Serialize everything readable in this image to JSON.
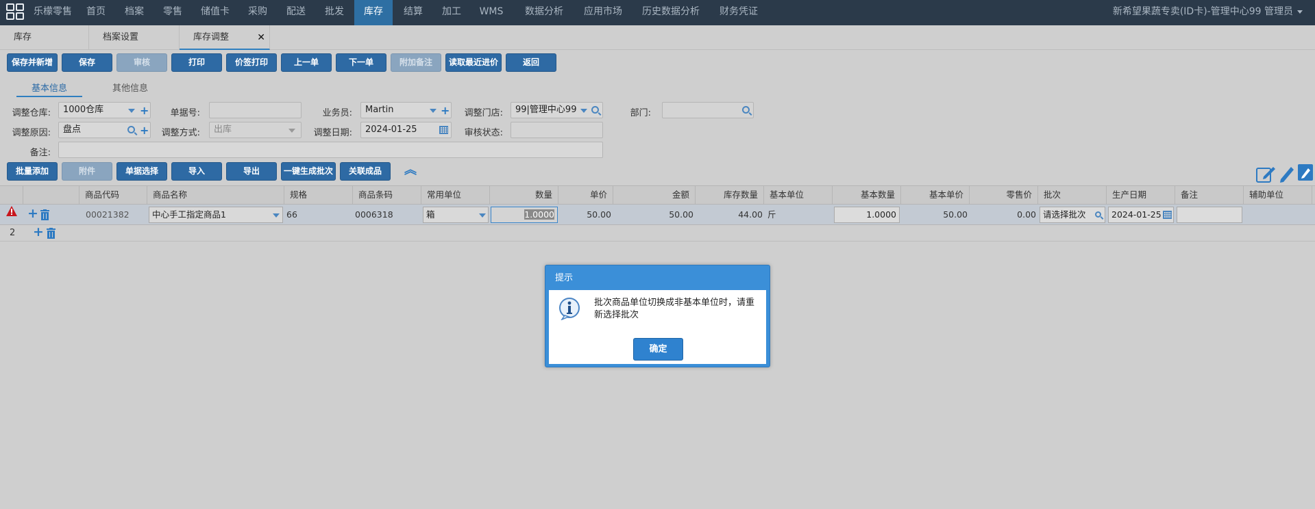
{
  "topnav": {
    "items": [
      "乐檬零售",
      "首页",
      "档案",
      "零售",
      "储值卡",
      "采购",
      "配送",
      "批发",
      "库存",
      "结算",
      "加工",
      "WMS",
      "数据分析",
      "应用市场",
      "历史数据分析",
      "财务凭证"
    ],
    "active": "库存",
    "user": "新希望果蔬专卖(ID卡)-管理中心99 管理员"
  },
  "tabs": [
    {
      "label": "库存"
    },
    {
      "label": "档案设置"
    },
    {
      "label": "库存调整"
    }
  ],
  "toolbar": {
    "buttons": [
      "保存并新增",
      "保存",
      "审核",
      "打印",
      "价签打印",
      "上一单",
      "下一单",
      "附加备注",
      "读取最近进价",
      "返回"
    ]
  },
  "subtabs": [
    "基本信息",
    "其他信息"
  ],
  "form": {
    "warehouse_label": "调整仓库:",
    "warehouse_value": "1000仓库",
    "docno_label": "单据号:",
    "docno_value": "",
    "salesman_label": "业务员:",
    "salesman_value": "Martin",
    "store_label": "调整门店:",
    "store_value": "99|管理中心99",
    "dept_label": "部门:",
    "dept_value": "",
    "reason_label": "调整原因:",
    "reason_value": "盘点",
    "method_label": "调整方式:",
    "method_value": "出库",
    "date_label": "调整日期:",
    "date_value": "2024-01-25",
    "status_label": "审核状态:",
    "status_value": "",
    "remark_label": "备注:",
    "remark_value": ""
  },
  "grid_toolbar": {
    "buttons": [
      "批量添加",
      "附件",
      "单据选择",
      "导入",
      "导出",
      "一键生成批次",
      "关联成品"
    ]
  },
  "grid": {
    "columns": [
      "商品代码",
      "商品名称",
      "规格",
      "商品条码",
      "常用单位",
      "数量",
      "单价",
      "金额",
      "库存数量",
      "基本单位",
      "基本数量",
      "基本单价",
      "零售价",
      "批次",
      "生产日期",
      "备注",
      "辅助单位"
    ],
    "rows": [
      {
        "code": "00021382",
        "name": "中心手工指定商品1",
        "spec": "66",
        "barcode": "0006318",
        "unit": "箱",
        "qty": "1.0000",
        "price": "50.00",
        "amount": "50.00",
        "stock": "44.00",
        "base_unit": "斤",
        "base_qty": "1.0000",
        "base_price": "50.00",
        "retail": "0.00",
        "batch": "请选择批次",
        "prod_date": "2024-01-25",
        "remark": "",
        "aux_unit": ""
      }
    ],
    "row2_no": "2"
  },
  "dialog": {
    "title": "提示",
    "message": "批次商品单位切换成非基本单位时，请重新选择批次",
    "ok": "确定"
  }
}
